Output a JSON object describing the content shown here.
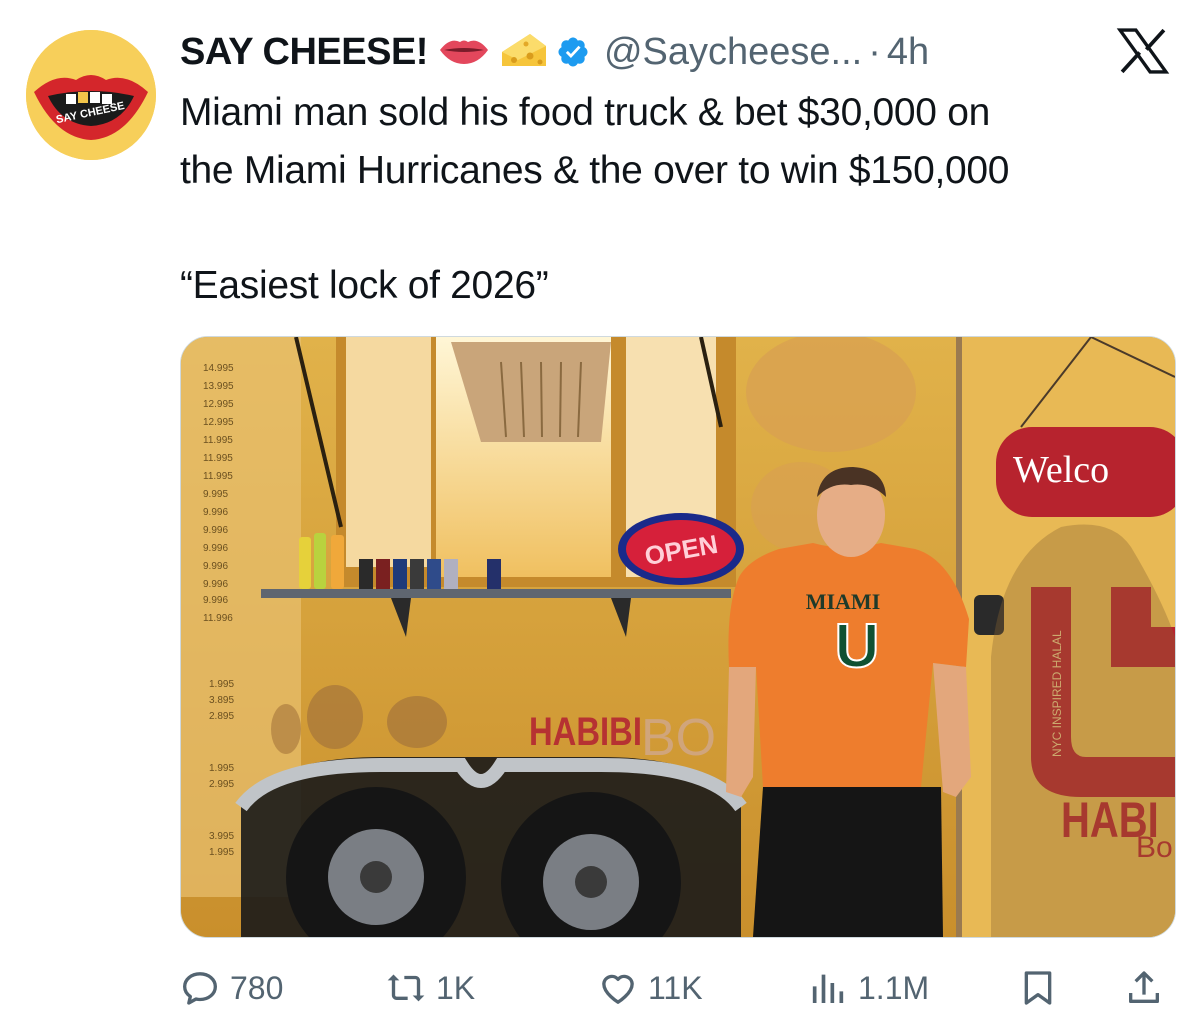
{
  "tweet": {
    "display_name": "SAY CHEESE!",
    "avatar_text": "SAY CHEESE",
    "handle": "@Saycheese...",
    "separator": "·",
    "time": "4h",
    "text_line1": "Miami man sold his food truck & bet $30,000 on",
    "text_line2": "the Miami Hurricanes & the over to win $150,000",
    "quote": "“Easiest lock of 2026”"
  },
  "image": {
    "sign_open": "OPEN",
    "sign_welcome": "Welco",
    "truck_brand": "HABIBI",
    "truck_brand_tail": "BO",
    "side_logo_text": "NYC INSPIRED HALAL",
    "side_brand": "HABI",
    "side_brand_sub": "Bo",
    "shirt_line1": "MIAMI",
    "shirt_letter": "U",
    "price_list": [
      "14.995",
      "13.995",
      "12.995",
      "12.995",
      "11.995",
      "11.995",
      "11.995",
      "9.995",
      "9.996",
      "9.996",
      "9.996",
      "9.996",
      "9.996",
      "9.996",
      "11.996"
    ],
    "price_list2": [
      "1.995",
      "3.895",
      "2.895"
    ],
    "price_list3": [
      "1.995",
      "2.995"
    ],
    "price_list4": [
      "3.995",
      "1.995"
    ]
  },
  "actions": {
    "replies": "780",
    "reposts": "1K",
    "likes": "11K",
    "views": "1.1M"
  },
  "icons": {
    "lips": "lips-emoji-icon",
    "cheese": "cheese-emoji-icon",
    "verified": "verified-badge-icon",
    "x": "x-logo-icon",
    "reply": "reply-icon",
    "repost": "repost-icon",
    "like": "heart-icon",
    "views": "views-icon",
    "bookmark": "bookmark-icon",
    "share": "share-icon"
  },
  "colors": {
    "verified_blue": "#1d9bf0",
    "secondary_text": "#536471",
    "primary_text": "#0f1419",
    "avatar_yellow": "#f7cf5a"
  }
}
